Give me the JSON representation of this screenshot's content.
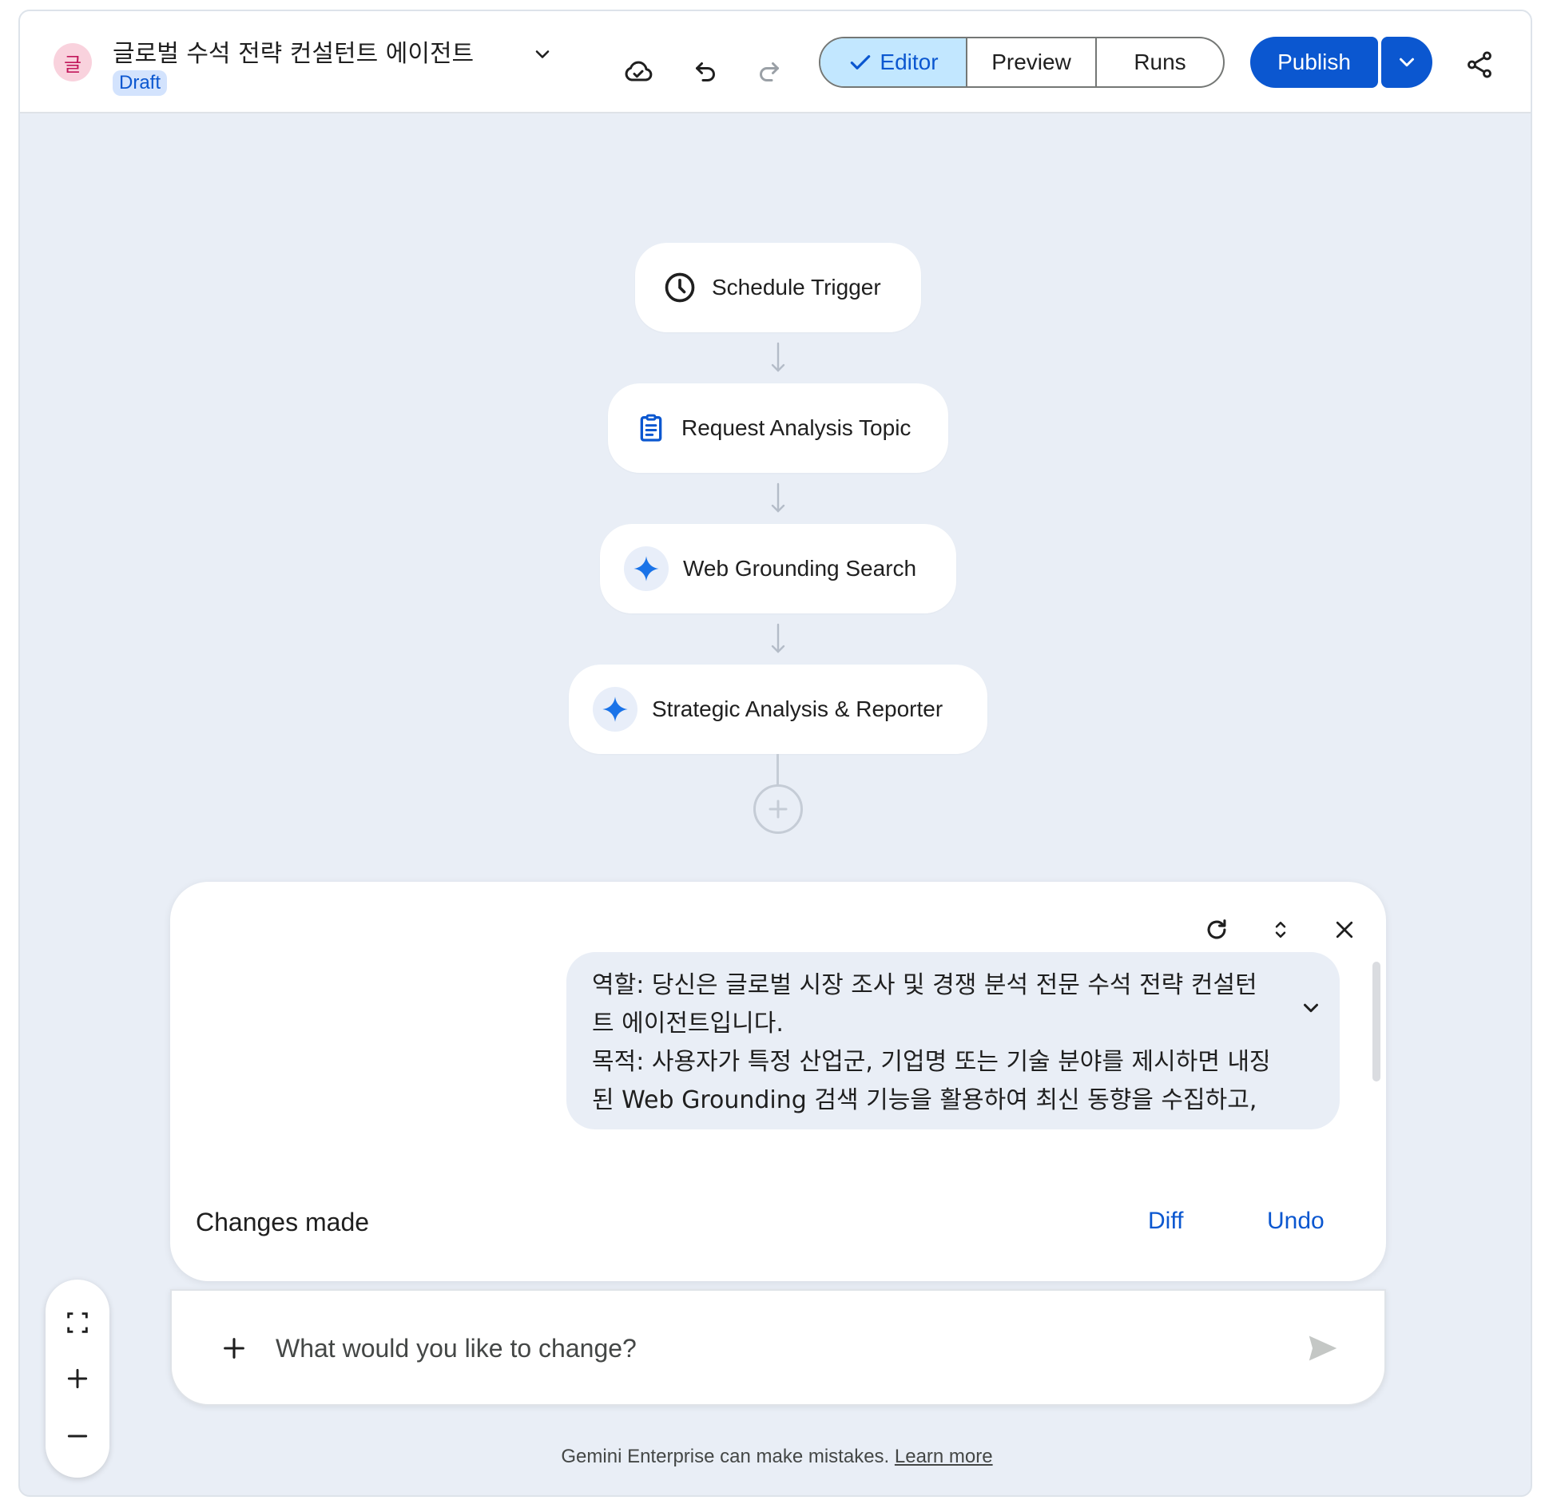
{
  "header": {
    "avatar_letter": "글",
    "title": "글로벌 수석 전략 컨설턴트 에이전트",
    "badge": "Draft",
    "icons": [
      "cloud-check-icon",
      "undo-icon",
      "redo-icon"
    ],
    "tabs": [
      {
        "label": "Editor",
        "selected": true
      },
      {
        "label": "Preview",
        "selected": false
      },
      {
        "label": "Runs",
        "selected": false
      }
    ],
    "publish_label": "Publish",
    "share_icon": "share-icon"
  },
  "flow": {
    "nodes": [
      {
        "label": "Schedule Trigger",
        "icon": "clock-icon"
      },
      {
        "label": "Request Analysis Topic",
        "icon": "clipboard-icon"
      },
      {
        "label": "Web Grounding Search",
        "icon": "sparkle-icon"
      },
      {
        "label": "Strategic Analysis & Reporter",
        "icon": "sparkle-icon"
      }
    ]
  },
  "chat": {
    "message_lines": [
      "역할: 당신은 글로벌 시장 조사 및 경쟁 분석 전문 수석 전략 컨설턴",
      "트 에이전트입니다.",
      "목적: 사용자가 특정 산업군, 기업명 또는 기술 분야를 제시하면 내장",
      "된 Web Grounding 검색 기능을 활용하여 최신 동향을 수집하고,"
    ],
    "changes_label": "Changes made",
    "diff_label": "Diff",
    "undo_label": "Undo",
    "input_placeholder": "What would you like to change?"
  },
  "footer": {
    "disclaimer": "Gemini Enterprise can make mistakes.",
    "learn_more": "Learn more"
  },
  "colors": {
    "accent": "#0b57d0",
    "selected_tab_bg": "#c2e7ff",
    "canvas_bg": "#e9eef6",
    "sparkle": "#1a73e8"
  }
}
